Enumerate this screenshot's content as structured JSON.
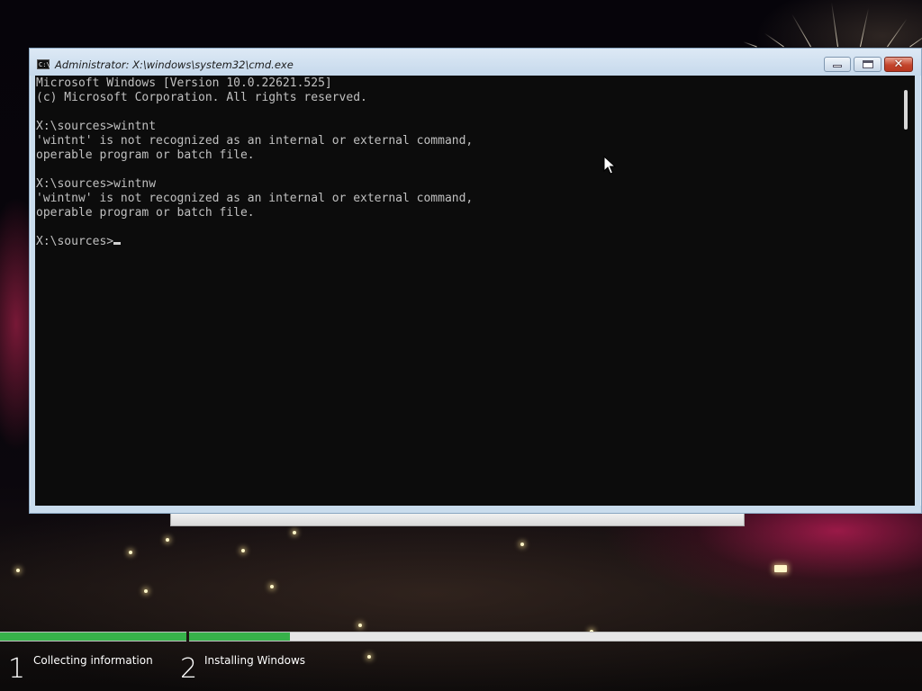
{
  "window": {
    "title": "Administrator: X:\\windows\\system32\\cmd.exe",
    "icon": "console-icon",
    "icon_text": "C:\\",
    "close_glyph": "✕"
  },
  "console": {
    "lines": [
      "Microsoft Windows [Version 10.0.22621.525]",
      "(c) Microsoft Corporation. All rights reserved.",
      "",
      "X:\\sources>wintnt",
      "'wintnt' is not recognized as an internal or external command,",
      "operable program or batch file.",
      "",
      "X:\\sources>wintnw",
      "'wintnw' is not recognized as an internal or external command,",
      "operable program or batch file.",
      ""
    ],
    "prompt": "X:\\sources>",
    "text_color": "#c0c0c0",
    "background_color": "#0c0c0c"
  },
  "setup": {
    "steps": [
      {
        "number": "1",
        "label": "Collecting information",
        "progress": 1.0
      },
      {
        "number": "2",
        "label": "Installing Windows",
        "progress": 0.138
      }
    ],
    "progress_color": "#37b24a",
    "track_color": "#e6e6e6"
  }
}
